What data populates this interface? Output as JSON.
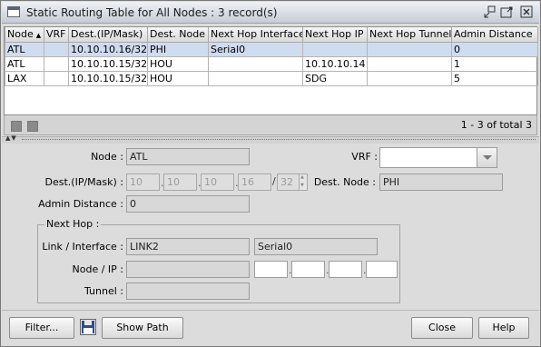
{
  "window": {
    "title": "Static Routing Table for All Nodes : 3 record(s)"
  },
  "table": {
    "columns": [
      "Node",
      "VRF",
      "Dest.(IP/Mask)",
      "Dest. Node",
      "Next Hop Interface",
      "Next Hop IP",
      "Next Hop Tunnel",
      "Admin Distance"
    ],
    "rows": [
      {
        "node": "ATL",
        "vrf": "",
        "dest": "10.10.10.16/32",
        "dest_node": "PHI",
        "nh_interface": "Serial0",
        "nh_ip": "",
        "nh_tunnel": "",
        "admin_distance": "0"
      },
      {
        "node": "ATL",
        "vrf": "",
        "dest": "10.10.10.15/32",
        "dest_node": "HOU",
        "nh_interface": "",
        "nh_ip": "10.10.10.14",
        "nh_tunnel": "",
        "admin_distance": "1"
      },
      {
        "node": "LAX",
        "vrf": "",
        "dest": "10.10.10.15/32",
        "dest_node": "HOU",
        "nh_interface": "",
        "nh_ip": "SDG",
        "nh_tunnel": "",
        "admin_distance": "5"
      }
    ],
    "records_label": "1 - 3 of total 3"
  },
  "form": {
    "node_label": "Node :",
    "node_value": "ATL",
    "vrf_label": "VRF :",
    "vrf_value": "",
    "dest_label": "Dest.(IP/Mask) :",
    "dest_ip": [
      "10",
      "10",
      "10",
      "16"
    ],
    "dest_mask": "32",
    "dest_node_label": "Dest. Node :",
    "dest_node_value": "PHI",
    "admin_distance_label": "Admin Distance :",
    "admin_distance_value": "0",
    "next_hop": {
      "title": "Next Hop :",
      "link_label": "Link / Interface :",
      "link_value": "LINK2",
      "interface_value": "Serial0",
      "node_ip_label": "Node / IP :",
      "node_value": "",
      "ip": [
        "",
        "",
        "",
        ""
      ],
      "tunnel_label": "Tunnel :",
      "tunnel_value": ""
    }
  },
  "buttons": {
    "filter": "Filter...",
    "show_path": "Show Path",
    "close": "Close",
    "help": "Help"
  }
}
